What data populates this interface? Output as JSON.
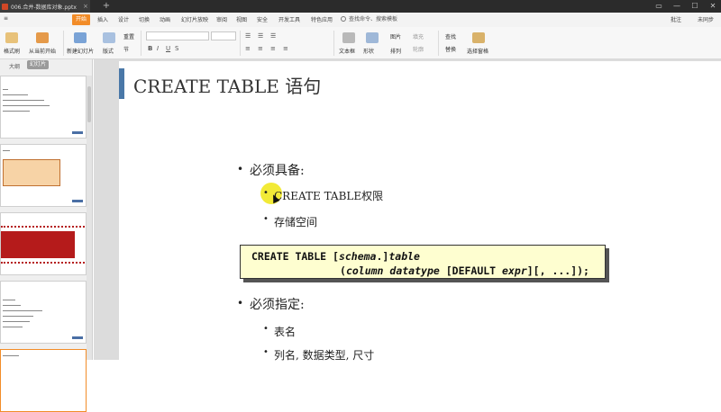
{
  "titlebar": {
    "tab_label": "006.合并-数据库对象.pptx",
    "close_glyph": "×",
    "new_tab_glyph": "+",
    "window_buttons": [
      "▭",
      "—",
      "☐",
      "✕"
    ]
  },
  "menu": {
    "app_glyph": "≡",
    "start": "开始",
    "items": [
      "插入",
      "设计",
      "切换",
      "动画",
      "幻灯片放映",
      "审阅",
      "视图",
      "安全",
      "开发工具",
      "特色应用"
    ],
    "search_placeholder": "查找命令、搜索模板",
    "right_items": [
      "批注",
      "未同步"
    ]
  },
  "ribbon": {
    "buttons": [
      "格式刷",
      "从当前开始",
      "新建幻灯片",
      "版式",
      "重置",
      "节",
      "文本框",
      "形状",
      "排列",
      "图片",
      "填充",
      "轮廓",
      "查找",
      "替换",
      "选择窗格"
    ]
  },
  "leftpanel": {
    "outline_tab": "大纲",
    "slides_tab": "幻灯片"
  },
  "slide": {
    "title": "CREATE TABLE 语句",
    "bullets": {
      "b1": "必须具备:",
      "b1a": "CREATE TABLE权限",
      "b1b": "存储空间",
      "b2": "必须指定:",
      "b2a": "表名",
      "b2b": "列名, 数据类型, 尺寸"
    },
    "code": {
      "l1_a": "CREATE TABLE [",
      "l1_b": "schema",
      "l1_c": ".]",
      "l1_d": "table",
      "l2_a": "(",
      "l2_b": "column datatype",
      "l2_c": " [DEFAULT ",
      "l2_d": "expr",
      "l2_e": "][, ...]);"
    }
  },
  "colors": {
    "accent_orange": "#f28c28",
    "title_bar_blue": "#4a78a8",
    "code_bg": "#fefed0",
    "highlight_yellow": "#f0e614"
  }
}
